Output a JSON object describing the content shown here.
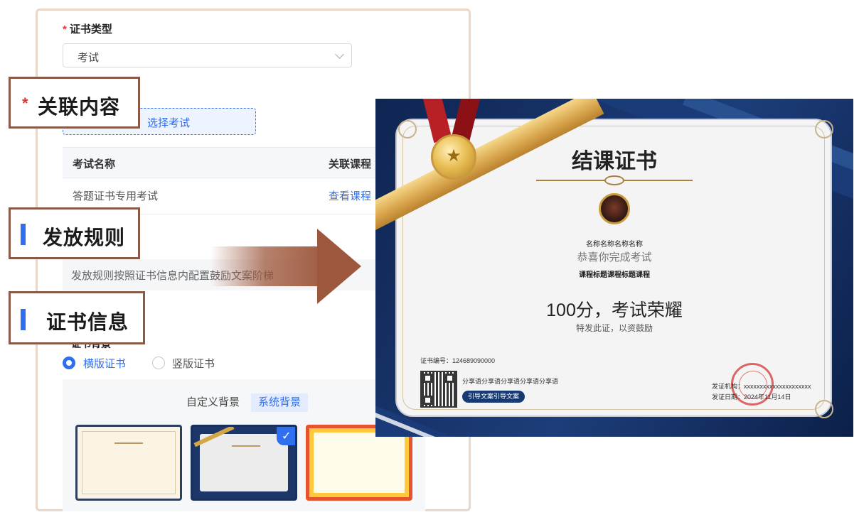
{
  "form": {
    "cert_type_label": "证书类型",
    "cert_type_value": "考试",
    "choose_exam_button": "选择考试",
    "table": {
      "headers": [
        "考试名称",
        "关联课程"
      ],
      "rows": [
        [
          "答题证书专用考试",
          "查看课程"
        ]
      ]
    },
    "rules_text": "发放规则按照证书信息内配置鼓励文案阶梯",
    "bg_label": "证书背景",
    "orientation_options": [
      {
        "label": "横版证书",
        "selected": true
      },
      {
        "label": "竖版证书",
        "selected": false
      }
    ],
    "bg_tabs": [
      {
        "label": "自定义背景",
        "active": false
      },
      {
        "label": "系统背景",
        "active": true
      }
    ],
    "thumbnails": [
      "cream-classic",
      "blue-ribbon-selected",
      "red-gold-frame"
    ]
  },
  "callouts": {
    "related_content": "关联内容",
    "issue_rules": "发放规则",
    "cert_info": "证书信息"
  },
  "certificate": {
    "title": "结课证书",
    "name": "名称名称名称名称",
    "congrats": "恭喜你完成考试",
    "course": "课程标题课程标题课程",
    "score": "100分，考试荣耀",
    "award": "特发此证，以资鼓励",
    "serial": "证书编号：124689090000",
    "share_text": "分享语分享语分享语分享语分享语",
    "guide_button": "引导文案引导文案",
    "issuer": "发证机构：xxxxxxxxxxxxxxxxxxxxx",
    "date": "发证日期：2024年11月14日",
    "medal_icon": "star-medal",
    "colors": {
      "frame": "#132c5e",
      "gold": "#d7a34a",
      "ribbon": "#b72024"
    }
  },
  "colors": {
    "accent": "#2f6ff0",
    "callout_border": "#8a5a48",
    "arrow": "#9d573c",
    "required": "#e0383b"
  }
}
